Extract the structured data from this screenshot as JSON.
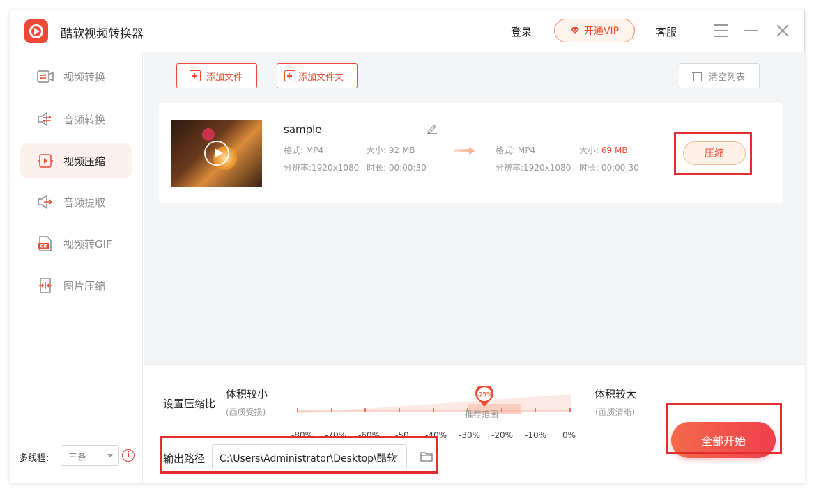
{
  "app": {
    "title": "酷软视频转换器"
  },
  "header": {
    "login": "登录",
    "vip": "开通VIP",
    "service": "客服"
  },
  "sidebar": {
    "items": [
      {
        "label": "视频转换",
        "icon": "video-convert-icon",
        "active": false
      },
      {
        "label": "音频转换",
        "icon": "audio-convert-icon",
        "active": false
      },
      {
        "label": "视频压缩",
        "icon": "video-compress-icon",
        "active": true
      },
      {
        "label": "音频提取",
        "icon": "audio-extract-icon",
        "active": false
      },
      {
        "label": "视频转GIF",
        "icon": "gif-icon",
        "active": false
      },
      {
        "label": "图片压缩",
        "icon": "image-compress-icon",
        "active": false
      }
    ],
    "threads_label": "多线程:",
    "threads_value": "三条",
    "info": "i"
  },
  "toolbar": {
    "add_file": "添加文件",
    "add_folder": "添加文件夹",
    "clear_list": "清空列表"
  },
  "file": {
    "name": "sample",
    "source": {
      "format": "格式: MP4",
      "size": "大小: 92 MB",
      "resolution": "分辨率:1920x1080",
      "duration": "时长: 00:00:30"
    },
    "output": {
      "format": "格式: MP4",
      "size_label": "大小:",
      "size_value": "69 MB",
      "resolution": "分辨率:1920x1080",
      "duration": "时长: 00:00:30"
    },
    "compress": "压缩"
  },
  "settings": {
    "label": "设置压缩比",
    "small": "体积较小",
    "small_sub": "(画质受损)",
    "large": "体积较大",
    "large_sub": "(画质清晰)",
    "recommend": "推荐范围",
    "value": "-25%",
    "ticks": [
      "-80%",
      "-70%",
      "-60%",
      "-50",
      "-40%",
      "-30%",
      "-20%",
      "-10%",
      "0%"
    ],
    "path_label": "输出路径",
    "path_value": "C:\\Users\\Administrator\\Desktop\\酷软",
    "start_all": "全部开始"
  },
  "colors": {
    "accent": "#ec4b34",
    "highlight": "#e22e2e"
  }
}
